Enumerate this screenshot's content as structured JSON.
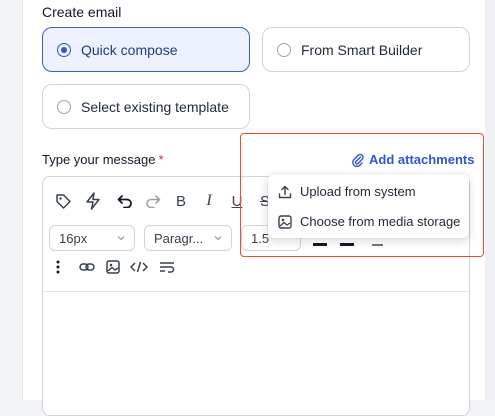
{
  "form": {
    "section_title": "Create email",
    "options": [
      {
        "label": "Quick compose",
        "selected": true
      },
      {
        "label": "From Smart Builder",
        "selected": false
      },
      {
        "label": "Select existing template",
        "selected": false
      }
    ],
    "message_label": "Type your message",
    "required_marker": "*",
    "add_attachments_label": "Add attachments"
  },
  "editor": {
    "font_size_value": "16px",
    "paragraph_value": "Paragr...",
    "line_height_value": "1.5",
    "toolbar_row1_icons": [
      "tag-icon",
      "lightning-icon",
      "undo-icon",
      "redo-icon",
      "bold-icon",
      "italic-icon",
      "underline-icon",
      "strikethrough-icon"
    ],
    "toolbar_row3_icons": [
      "more-vertical-icon",
      "link-icon",
      "image-icon",
      "code-icon",
      "text-wrap-icon"
    ]
  },
  "attachments_menu": {
    "items": [
      {
        "label": "Upload from system",
        "icon": "upload-icon"
      },
      {
        "label": "Choose from media storage",
        "icon": "image-icon"
      }
    ]
  },
  "colors": {
    "accent": "#2f55d4",
    "selected_bg": "#eef2ff",
    "highlight_border": "#ef4b2c",
    "required": "#dc2626"
  }
}
